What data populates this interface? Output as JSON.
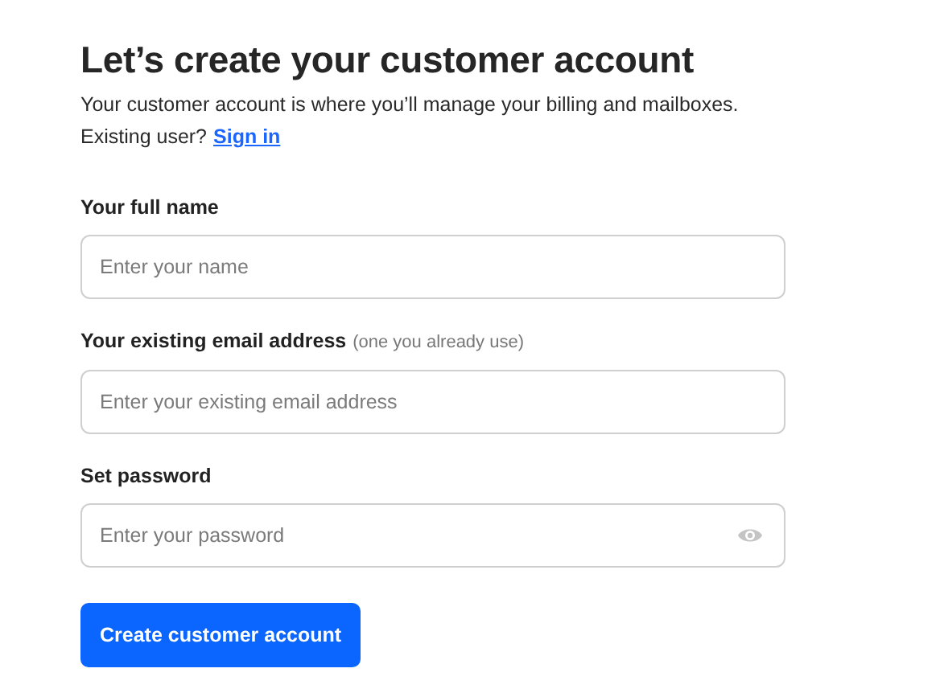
{
  "title": "Let’s create your customer account",
  "intro": "Your customer account is where you’ll manage your billing and mailboxes.",
  "signin": {
    "prompt": "Existing user?",
    "link": "Sign in"
  },
  "fields": [
    {
      "kind": "text",
      "label": "Your full name",
      "placeholder": "Enter your name"
    },
    {
      "kind": "email",
      "label": "Your existing email address",
      "hint": "(one you already use)",
      "placeholder": "Enter your existing email address"
    },
    {
      "kind": "password",
      "label": "Set password",
      "placeholder": "Enter your password"
    }
  ],
  "submit": "Create customer account"
}
